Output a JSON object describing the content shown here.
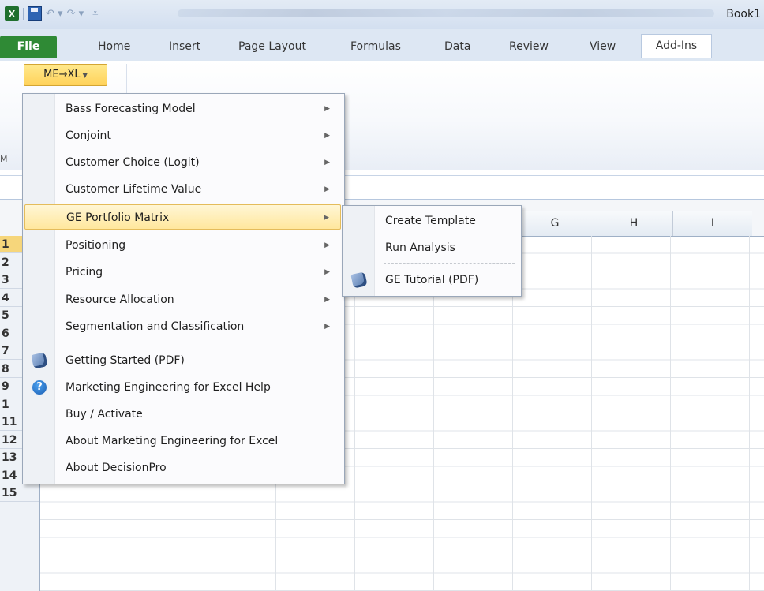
{
  "title_bar": {
    "book_name": "Book1"
  },
  "tabs": [
    "File",
    "Home",
    "Insert",
    "Page Layout",
    "Formulas",
    "Data",
    "Review",
    "View",
    "Add-Ins"
  ],
  "ribbon": {
    "addin_button": "ME→XL",
    "group_caption": "M"
  },
  "columns": [
    "G",
    "H",
    "I"
  ],
  "rows": [
    "1",
    "2",
    "3",
    "4",
    "5",
    "6",
    "7",
    "8",
    "9",
    "1",
    "11",
    "12",
    "13",
    "14",
    "15"
  ],
  "main_menu": {
    "items": [
      {
        "label": "Bass Forecasting Model",
        "submenu": true
      },
      {
        "label": "Conjoint",
        "submenu": true
      },
      {
        "label": "Customer Choice (Logit)",
        "submenu": true
      },
      {
        "label": "Customer Lifetime Value",
        "submenu": true
      },
      {
        "label": "GE Portfolio Matrix",
        "submenu": true,
        "highlighted": true
      },
      {
        "label": "Positioning",
        "submenu": true
      },
      {
        "label": "Pricing",
        "submenu": true
      },
      {
        "label": "Resource Allocation",
        "submenu": true
      },
      {
        "label": "Segmentation and Classification",
        "submenu": true
      },
      {
        "label": "Getting Started (PDF)",
        "icon": "pdf-book-icon"
      },
      {
        "label": "Marketing Engineering for Excel Help",
        "icon": "help-icon"
      },
      {
        "label": "Buy / Activate"
      },
      {
        "label": "About Marketing Engineering for Excel"
      },
      {
        "label": "About DecisionPro"
      }
    ]
  },
  "sub_menu": {
    "items": [
      {
        "label": "Create Template"
      },
      {
        "label": "Run Analysis"
      },
      {
        "label": "GE Tutorial (PDF)",
        "icon": "pdf-book-icon"
      }
    ]
  },
  "colors": {
    "file_tab": "#2f8a35",
    "highlight": "#ffe79d",
    "addin_button": "#ffd25a"
  }
}
